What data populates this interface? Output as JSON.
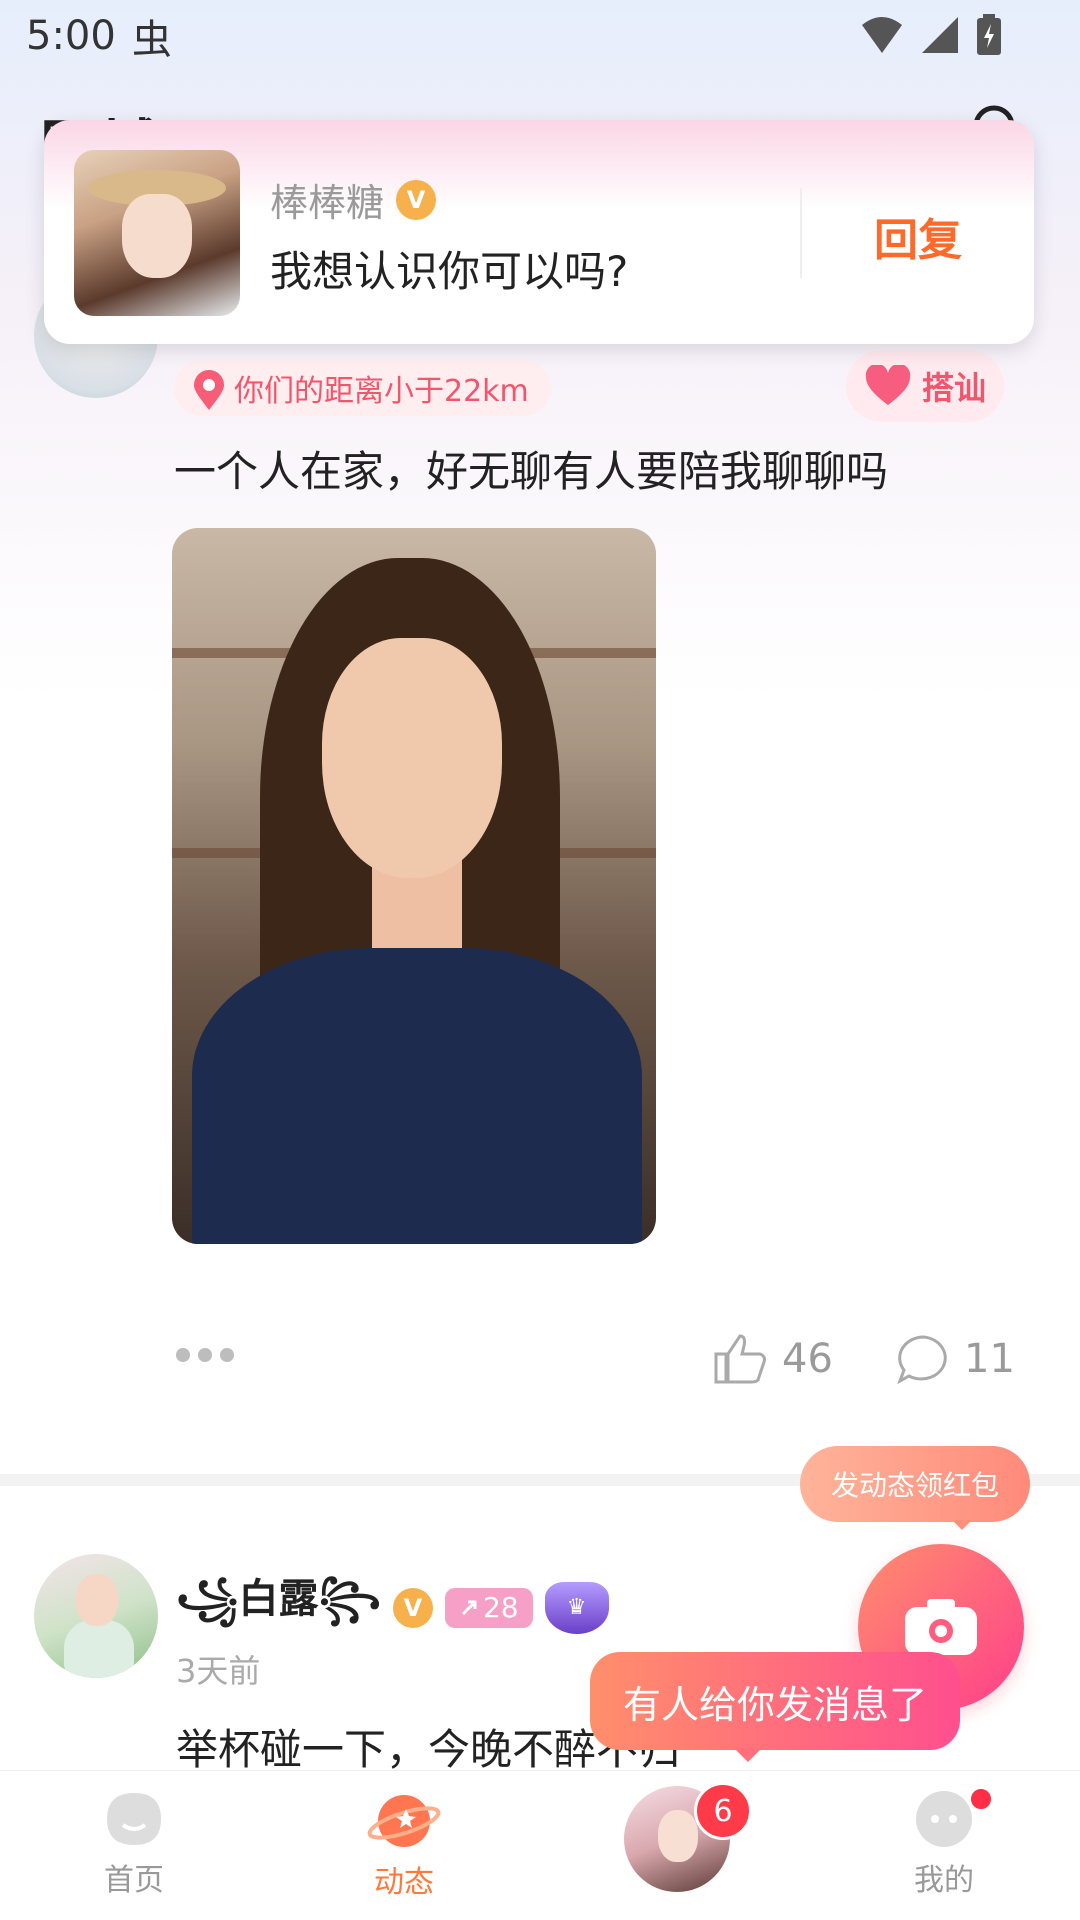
{
  "status_bar": {
    "time": "5:00",
    "bug_glyph": "虫"
  },
  "header": {
    "title": "同城"
  },
  "notification": {
    "sender_name": "棒棒糖",
    "verified_mark": "V",
    "message": "我想认识你可以吗?",
    "reply_label": "回复"
  },
  "post1": {
    "distance": "你们的距离小于22km",
    "chat_label": "搭讪",
    "text": "一个人在家，好无聊有人要陪我聊聊吗",
    "likes": "46",
    "comments": "11"
  },
  "post2": {
    "nickname": "꧁白露꧂",
    "verified_mark": "V",
    "level": "28",
    "time": "3天前",
    "text": "举杯碰一下，今晚不醉不归"
  },
  "floating": {
    "redpack_tip": "发动态领红包",
    "message_tip": "有人给你发消息了"
  },
  "tabbar": {
    "home": "首页",
    "moments": "动态",
    "mine": "我的",
    "message_count": "6"
  },
  "colors": {
    "accent": "#ff7a3a",
    "pink": "#f2566c",
    "badge_red": "#ff3b4a"
  },
  "icons": [
    "bug-icon",
    "wifi-icon",
    "signal-icon",
    "battery-icon",
    "search-icon",
    "verified-icon",
    "location-pin-icon",
    "heart-icon",
    "more-icon",
    "like-icon",
    "comment-icon",
    "camera-icon",
    "home-icon",
    "moments-icon",
    "mine-icon",
    "rank-icon"
  ]
}
